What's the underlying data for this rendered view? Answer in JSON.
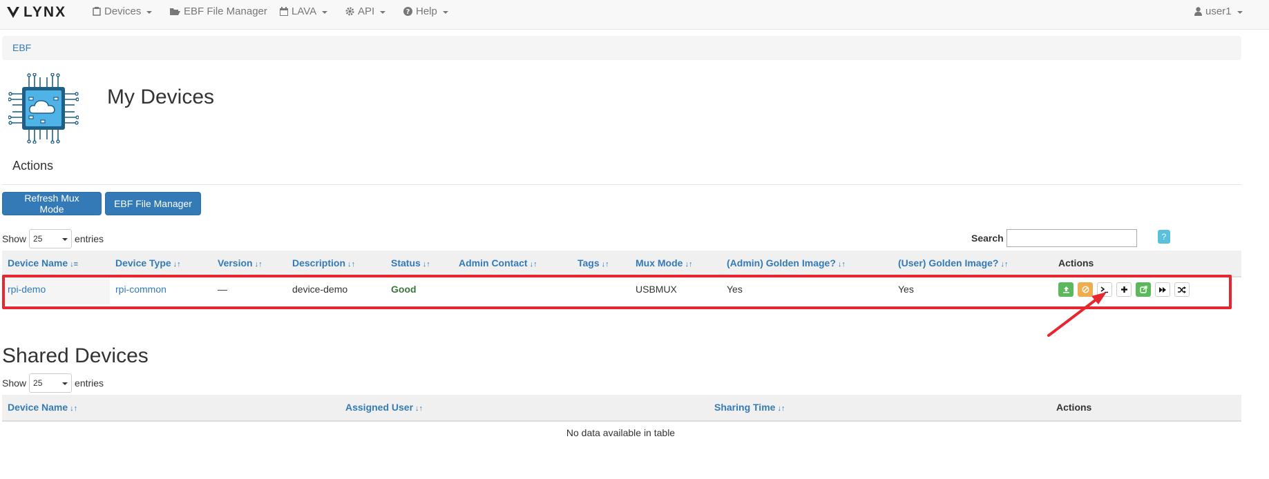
{
  "nav": {
    "brand": "LYNX",
    "items": [
      {
        "label": "Devices",
        "icon": "devices-icon",
        "dropdown": true
      },
      {
        "label": "EBF File Manager",
        "icon": "folder-open-icon",
        "dropdown": false
      },
      {
        "label": "LAVA",
        "icon": "calendar-icon",
        "dropdown": true
      },
      {
        "label": "API",
        "icon": "gear-icon",
        "dropdown": true
      },
      {
        "label": "Help",
        "icon": "question-circle-icon",
        "dropdown": true
      }
    ],
    "user": "user1"
  },
  "breadcrumb": {
    "label": "EBF"
  },
  "page": {
    "title": "My Devices",
    "actions_heading": "Actions"
  },
  "buttons": {
    "refresh_mux": "Refresh Mux Mode",
    "ebf_file_manager": "EBF File Manager"
  },
  "my_devices_table": {
    "show_label": "Show",
    "entries_label": "entries",
    "page_size": "25",
    "search_label": "Search",
    "search_value": "",
    "help_label": "?",
    "columns": [
      "Device Name",
      "Device Type",
      "Version",
      "Description",
      "Status",
      "Admin Contact",
      "Tags",
      "Mux Mode",
      "(Admin) Golden Image?",
      "(User) Golden Image?",
      "Actions"
    ],
    "rows": [
      {
        "device_name": "rpi-demo",
        "device_type": "rpi-common",
        "version": "—",
        "description": "device-demo",
        "status": "Good",
        "admin_contact": "",
        "tags": "",
        "mux_mode": "USBMUX",
        "admin_golden": "Yes",
        "user_golden": "Yes",
        "actions": [
          "upload-icon",
          "ban-icon",
          "terminal-icon",
          "plus-icon",
          "share-icon",
          "forward-icon",
          "random-icon"
        ]
      }
    ]
  },
  "shared_devices": {
    "title": "Shared Devices",
    "show_label": "Show",
    "entries_label": "entries",
    "page_size": "25",
    "columns": [
      "Device Name",
      "Assigned User",
      "Sharing Time",
      "Actions"
    ],
    "empty_message": "No data available in table"
  },
  "colors": {
    "link": "#337ab7",
    "primary": "#337ab7",
    "success": "#5cb85c",
    "warning": "#f0ad4e",
    "info": "#5bc0de",
    "highlight": "#e8262f"
  }
}
